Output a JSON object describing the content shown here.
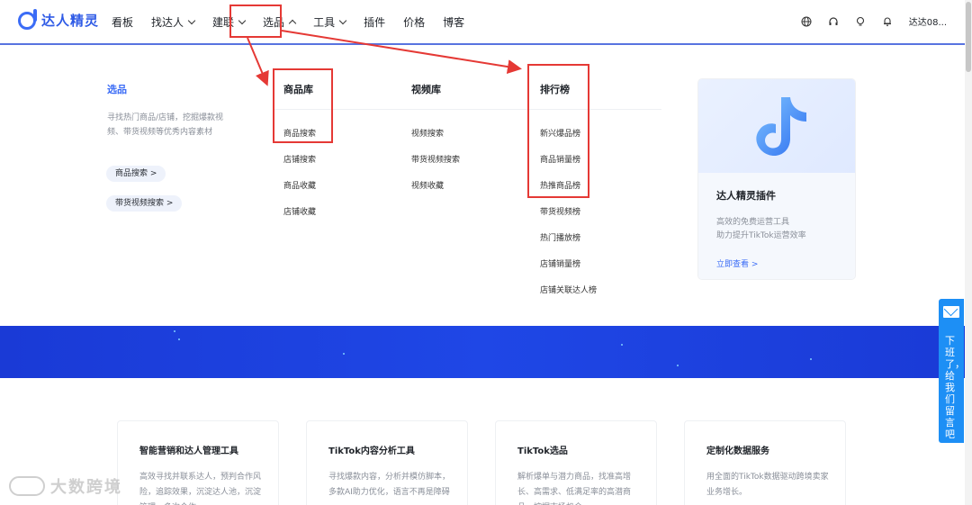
{
  "app": {
    "logo_text": "达人精灵"
  },
  "nav": {
    "items": [
      {
        "label": "看板",
        "chevron": false
      },
      {
        "label": "找达人",
        "chevron": "down"
      },
      {
        "label": "建联",
        "chevron": "down"
      },
      {
        "label": "选品",
        "chevron": "up"
      },
      {
        "label": "工具",
        "chevron": "down"
      },
      {
        "label": "插件",
        "chevron": false
      },
      {
        "label": "价格",
        "chevron": false
      },
      {
        "label": "博客",
        "chevron": false
      }
    ],
    "user_name": "达达08...",
    "icons": [
      "globe-icon",
      "headset-icon",
      "lightbulb-icon",
      "bell-icon"
    ]
  },
  "dropdown": {
    "section_title": "选品",
    "section_desc": "寻找热门商品/店铺，挖掘爆款视频、带货视频等优秀内容素材",
    "pills": [
      "商品搜索 >",
      "带货视频搜索 >"
    ],
    "columns": [
      {
        "title": "商品库",
        "links": [
          "商品搜索",
          "店铺搜索",
          "商品收藏",
          "店铺收藏"
        ]
      },
      {
        "title": "视频库",
        "links": [
          "视频搜索",
          "带货视频搜索",
          "视频收藏"
        ]
      },
      {
        "title": "排行榜",
        "links": [
          "新兴爆品榜",
          "商品销量榜",
          "热推商品榜",
          "带货视频榜",
          "热门播放榜",
          "店铺销量榜",
          "店铺关联达人榜"
        ]
      }
    ],
    "promo": {
      "title": "达人精灵插件",
      "desc_line1": "高效的免费运营工具",
      "desc_line2": "助力提升TikTok运营效率",
      "link": "立即查看 >"
    }
  },
  "features": [
    {
      "title": "智能营销和达人管理工具",
      "desc": "高效寻找并联系达人，预判合作风险，追踪效果，沉淀达人池，沉淀管理，多次合作"
    },
    {
      "title": "TikTok内容分析工具",
      "desc": "寻找爆款内容，分析并模仿脚本，多款AI助力优化，语言不再是障碍"
    },
    {
      "title": "TikTok选品",
      "desc": "解析爆单与潜力商品，找准高增长、高需求、低满足率的高潜商品，挖掘市场机会"
    },
    {
      "title": "定制化数据服务",
      "desc": "用全面的TikTok数据驱动跨境卖家业务增长。"
    }
  ],
  "side_widget": {
    "text": "下班了，给我们留言吧"
  },
  "watermark": {
    "text": "大数跨境"
  },
  "colors": {
    "brand": "#3b6cf6",
    "highlight": "#e53935",
    "banner": "#1f47e6",
    "side": "#1d8ff5"
  }
}
